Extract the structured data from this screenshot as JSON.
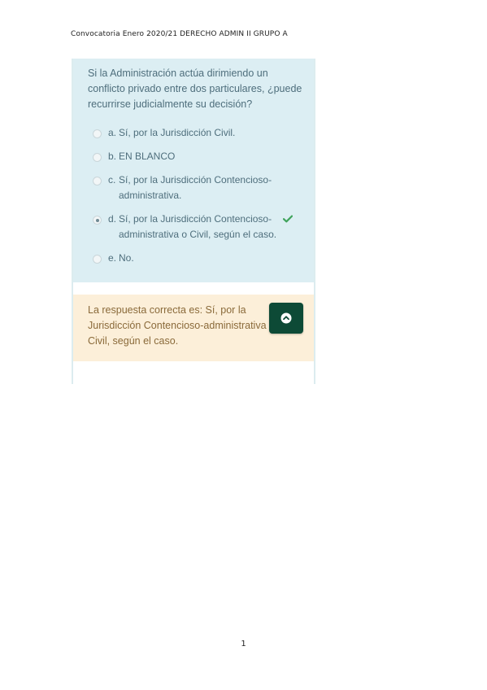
{
  "header": {
    "title": "Convocatoria Enero 2020/21 DERECHO ADMIN II GRUPO A"
  },
  "question": {
    "text": "Si la Administración actúa dirimiendo un conflicto privado entre dos particulares, ¿puede recurrirse judicialmente su decisión?",
    "answers": [
      {
        "letter": "a.",
        "text": "Sí, por la Jurisdicción Civil.",
        "selected": false
      },
      {
        "letter": "b.",
        "text": "EN BLANCO",
        "selected": false
      },
      {
        "letter": "c.",
        "text": "Sí, por la Jurisdicción Contencioso-administrativa.",
        "selected": false
      },
      {
        "letter": "d.",
        "text": "Sí, por la Jurisdicción Contencioso-administrativa o Civil, según el caso.",
        "selected": true,
        "mark": "check-icon"
      },
      {
        "letter": "e.",
        "text": "No.",
        "selected": false
      }
    ]
  },
  "feedback": {
    "text": "La respuesta correcta es: Sí, por la Jurisdicción Contencioso-administrativa o Civil, según el caso."
  },
  "scroll_top_button": {
    "icon": "chevron-up-icon"
  },
  "footer": {
    "page_number": "1"
  },
  "colors": {
    "question_bg": "#dceef3",
    "feedback_bg": "#fcefd9",
    "button_bg": "#0d4a36",
    "check": "#3fa35b"
  }
}
